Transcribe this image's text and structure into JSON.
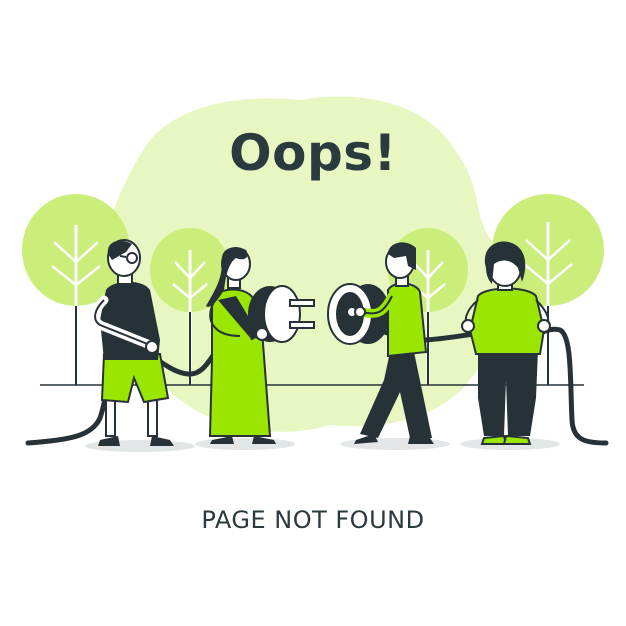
{
  "headline": "Oops!",
  "message": "PAGE NOT FOUND",
  "colors": {
    "accent": "#9be600",
    "blob": "#e8f7c2",
    "tree": "#cbee7a",
    "dark": "#263238",
    "skin": "#ffffff"
  },
  "illustration": {
    "icon": "unplugged-cable-illustration"
  }
}
